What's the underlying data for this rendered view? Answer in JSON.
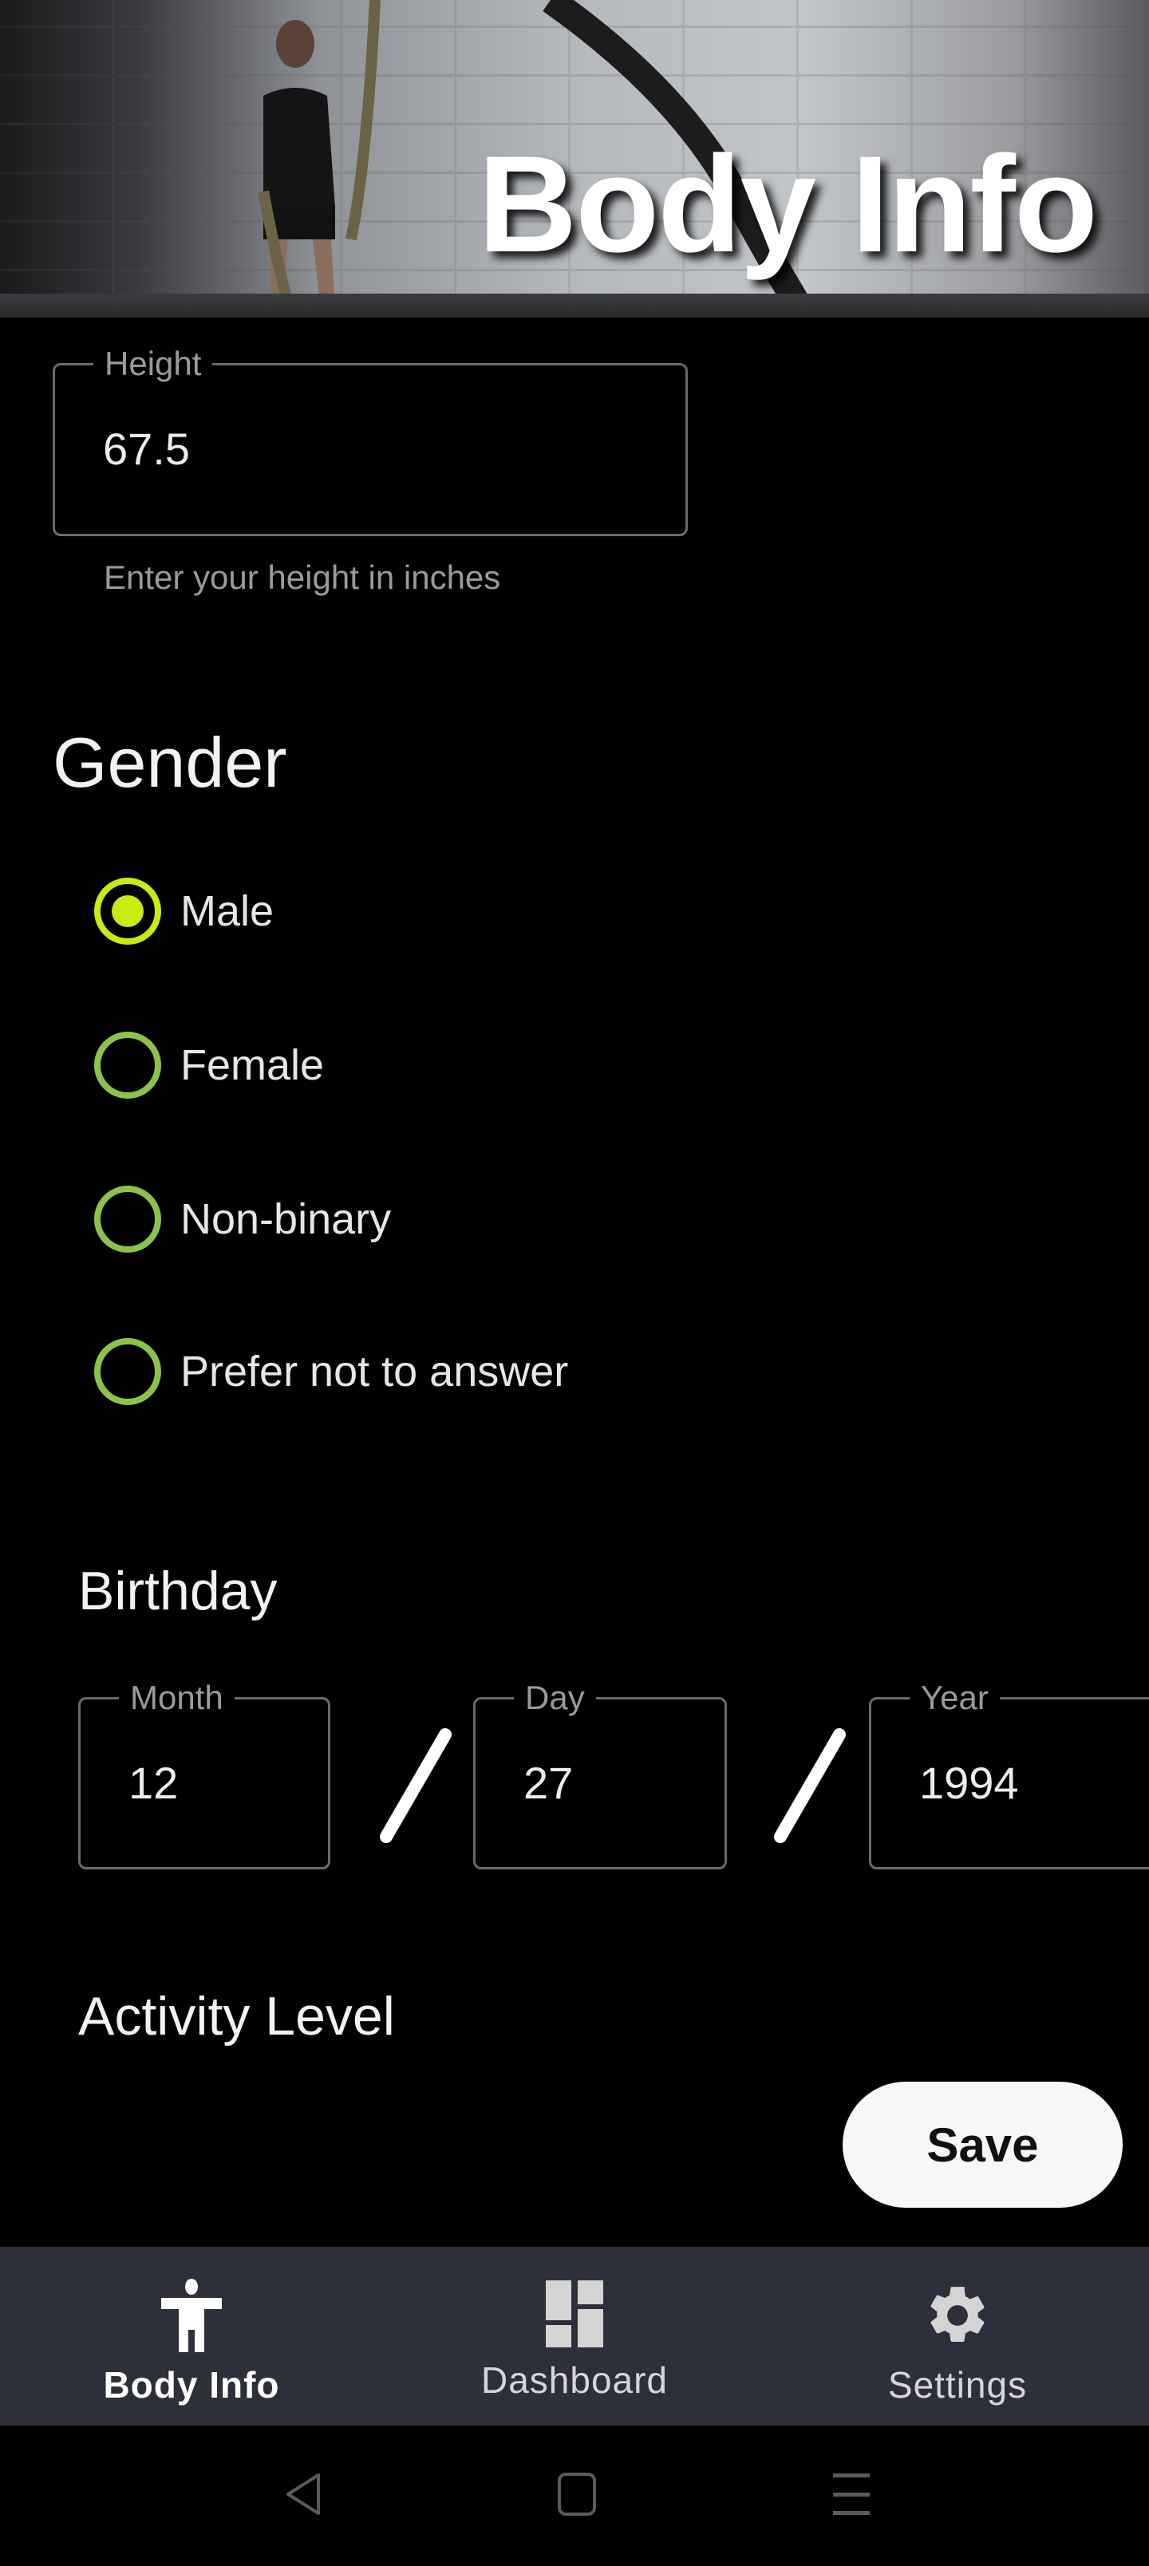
{
  "header": {
    "title": "Body Info"
  },
  "height_field": {
    "label": "Height",
    "value": "67.5",
    "helper": "Enter your height in inches"
  },
  "gender": {
    "heading": "Gender",
    "options": [
      {
        "label": "Male",
        "selected": true
      },
      {
        "label": "Female",
        "selected": false
      },
      {
        "label": "Non-binary",
        "selected": false
      },
      {
        "label": "Prefer not to answer",
        "selected": false
      }
    ]
  },
  "birthday": {
    "heading": "Birthday",
    "month": {
      "label": "Month",
      "value": "12"
    },
    "day": {
      "label": "Day",
      "value": "27"
    },
    "year": {
      "label": "Year",
      "value": "1994"
    }
  },
  "activity": {
    "heading": "Activity Level"
  },
  "save_label": "Save",
  "bottom_nav": {
    "items": [
      {
        "label": "Body Info",
        "icon": "accessibility-icon",
        "active": true
      },
      {
        "label": "Dashboard",
        "icon": "dashboard-icon",
        "active": false
      },
      {
        "label": "Settings",
        "icon": "gear-icon",
        "active": false
      }
    ]
  },
  "colors": {
    "radio_selected": "#c6ec10",
    "radio_unselected": "#8bc34a",
    "nav_bg": "#2d2f3a",
    "background": "#000000"
  }
}
